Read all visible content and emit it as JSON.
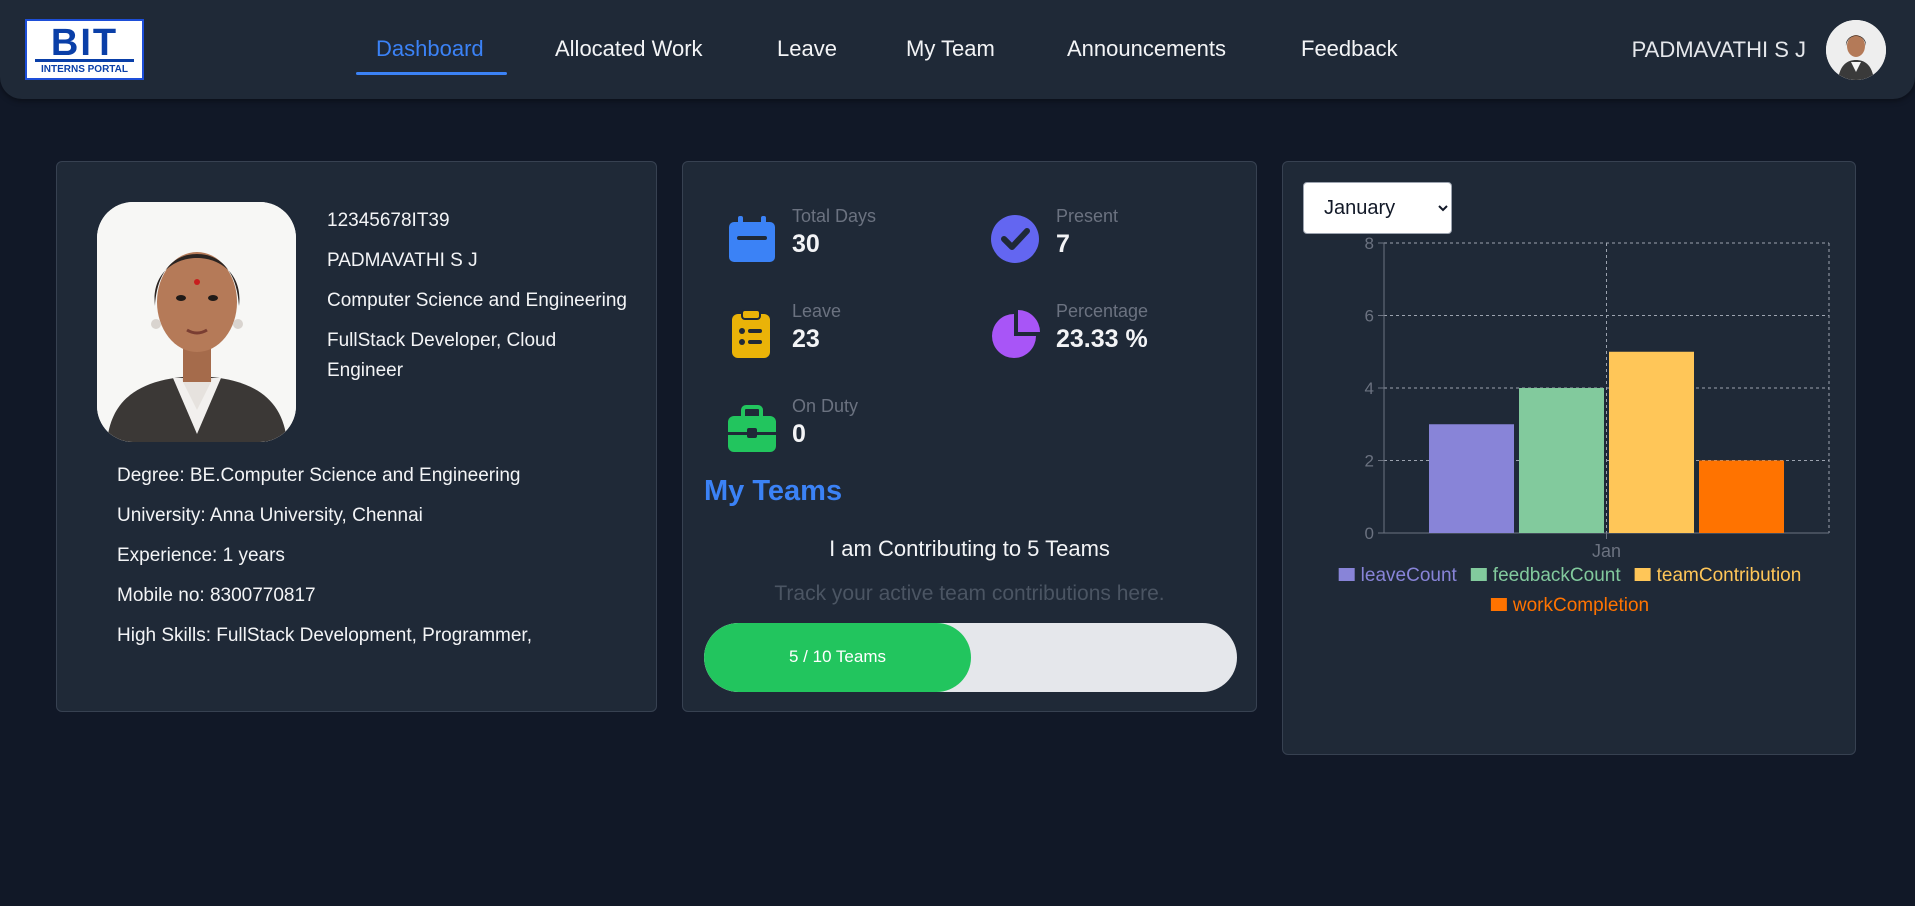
{
  "brand": {
    "logo_text": "BIT",
    "logo_sub": "INTERNS PORTAL"
  },
  "nav": {
    "items": [
      {
        "label": "Dashboard",
        "active": true
      },
      {
        "label": "Allocated Work",
        "active": false
      },
      {
        "label": "Leave",
        "active": false
      },
      {
        "label": "My Team",
        "active": false
      },
      {
        "label": "Announcements",
        "active": false
      },
      {
        "label": "Feedback",
        "active": false
      }
    ]
  },
  "user": {
    "name": "PADMAVATHI S J"
  },
  "profile": {
    "id": "12345678IT39",
    "name": "PADMAVATHI S J",
    "department": "Computer Science and Engineering",
    "role": "FullStack Developer, Cloud Engineer",
    "details": [
      "Degree: BE.Computer Science and Engineering",
      "University: Anna University, Chennai",
      "Experience: 1 years",
      "Mobile no: 8300770817",
      "High Skills: FullStack Development, Programmer,"
    ]
  },
  "stats": {
    "total_days": {
      "label": "Total Days",
      "value": "30",
      "icon": "calendar-icon",
      "color": "#3b82f6"
    },
    "present": {
      "label": "Present",
      "value": "7",
      "icon": "check-circle-icon",
      "color": "#6366f1"
    },
    "leave": {
      "label": "Leave",
      "value": "23",
      "icon": "clipboard-list-icon",
      "color": "#eab308"
    },
    "percentage": {
      "label": "Percentage",
      "value": "23.33 %",
      "icon": "pie-chart-icon",
      "color": "#a855f7"
    },
    "on_duty": {
      "label": "On Duty",
      "value": "0",
      "icon": "briefcase-icon",
      "color": "#22c55e"
    }
  },
  "teams": {
    "title": "My Teams",
    "contributing_text": "I am Contributing to 5 Teams",
    "subtitle": "Track your active team contributions here.",
    "progress_text": "5 / 10 Teams",
    "progress_fraction": 0.5
  },
  "month_select": {
    "selected": "January"
  },
  "colors": {
    "accent": "#3b82f6",
    "card": "#1f2937",
    "background": "#111827"
  },
  "chart_data": {
    "type": "bar",
    "categories": [
      "Jan"
    ],
    "ylim": [
      0,
      8
    ],
    "yticks": [
      0,
      2,
      4,
      6,
      8
    ],
    "grid": true,
    "legend_position": "bottom",
    "series": [
      {
        "name": "leaveCount",
        "values": [
          3
        ],
        "color": "#8884d8"
      },
      {
        "name": "feedbackCount",
        "values": [
          4
        ],
        "color": "#82ca9d"
      },
      {
        "name": "teamContribution",
        "values": [
          5
        ],
        "color": "#ffc658"
      },
      {
        "name": "workCompletion",
        "values": [
          2
        ],
        "color": "#ff7300"
      }
    ]
  }
}
